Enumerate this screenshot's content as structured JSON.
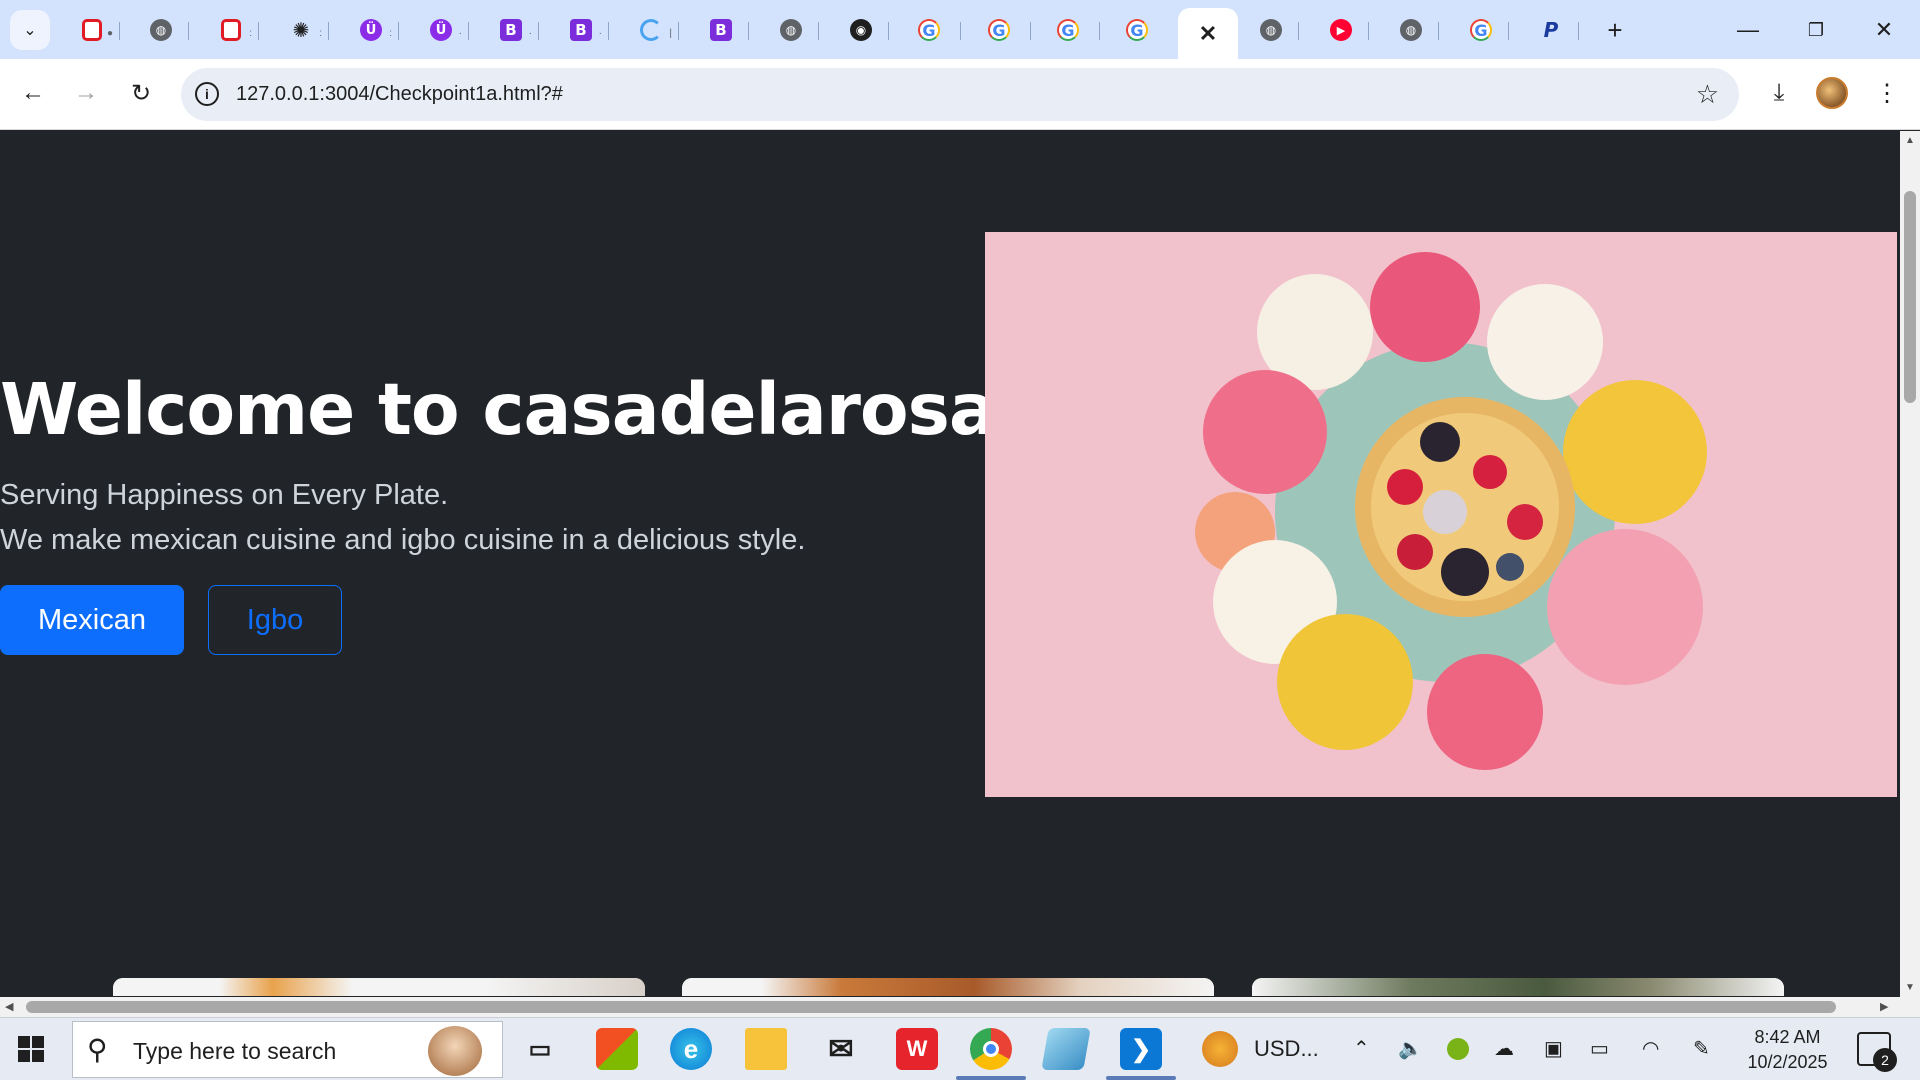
{
  "browser": {
    "tabs": [
      {
        "icon": "opera-icon",
        "glyph": "O"
      },
      {
        "icon": "globe-icon",
        "glyph": "◍"
      },
      {
        "icon": "opera-icon",
        "glyph": "O"
      },
      {
        "icon": "openai-icon",
        "glyph": "✺"
      },
      {
        "icon": "unicode-icon",
        "glyph": "Ü"
      },
      {
        "icon": "unicode-icon",
        "glyph": "Ü"
      },
      {
        "icon": "b-icon",
        "glyph": "B"
      },
      {
        "icon": "b-icon",
        "glyph": "B"
      },
      {
        "icon": "loading-icon",
        "glyph": ""
      },
      {
        "icon": "b-icon",
        "glyph": "B"
      },
      {
        "icon": "globe-icon",
        "glyph": "◍"
      },
      {
        "icon": "github-icon",
        "glyph": "◉"
      },
      {
        "icon": "google-icon",
        "glyph": "G"
      },
      {
        "icon": "google-icon",
        "glyph": "G"
      },
      {
        "icon": "google-icon",
        "glyph": "G"
      },
      {
        "icon": "google-icon",
        "glyph": "G"
      },
      {
        "icon": "active-tab-close-icon",
        "glyph": "✕"
      },
      {
        "icon": "globe-icon",
        "glyph": "◍"
      },
      {
        "icon": "youtube-icon",
        "glyph": "▶"
      },
      {
        "icon": "globe-icon",
        "glyph": "◍"
      },
      {
        "icon": "google-icon",
        "glyph": "G"
      },
      {
        "icon": "paypal-icon",
        "glyph": "P"
      }
    ],
    "new_tab_glyph": "+",
    "url": "127.0.0.1:3004/Checkpoint1a.html?#",
    "colors": {
      "tabstrip": "#d3e3fd",
      "omnibox": "#e9eef6"
    }
  },
  "hero": {
    "title": "Welcome to casadelarosa",
    "tagline": "Serving Happiness on Every Plate.",
    "description": "We make mexican cuisine and igbo cuisine in a delicious style.",
    "primary_button": "Mexican",
    "secondary_button": "Igbo",
    "accent_color": "#0d6efd",
    "background": "#212529"
  },
  "taskbar": {
    "search_placeholder": "Type here to search",
    "pinned": [
      {
        "name": "task-view-icon"
      },
      {
        "name": "microsoft-store-icon"
      },
      {
        "name": "edge-icon"
      },
      {
        "name": "file-explorer-icon"
      },
      {
        "name": "mail-icon"
      },
      {
        "name": "wps-office-icon"
      },
      {
        "name": "chrome-icon"
      },
      {
        "name": "notepad-icon"
      },
      {
        "name": "vscode-icon"
      }
    ],
    "currency_widget": "USD...",
    "time": "8:42 AM",
    "date": "10/2/2025",
    "notification_count": "2"
  }
}
